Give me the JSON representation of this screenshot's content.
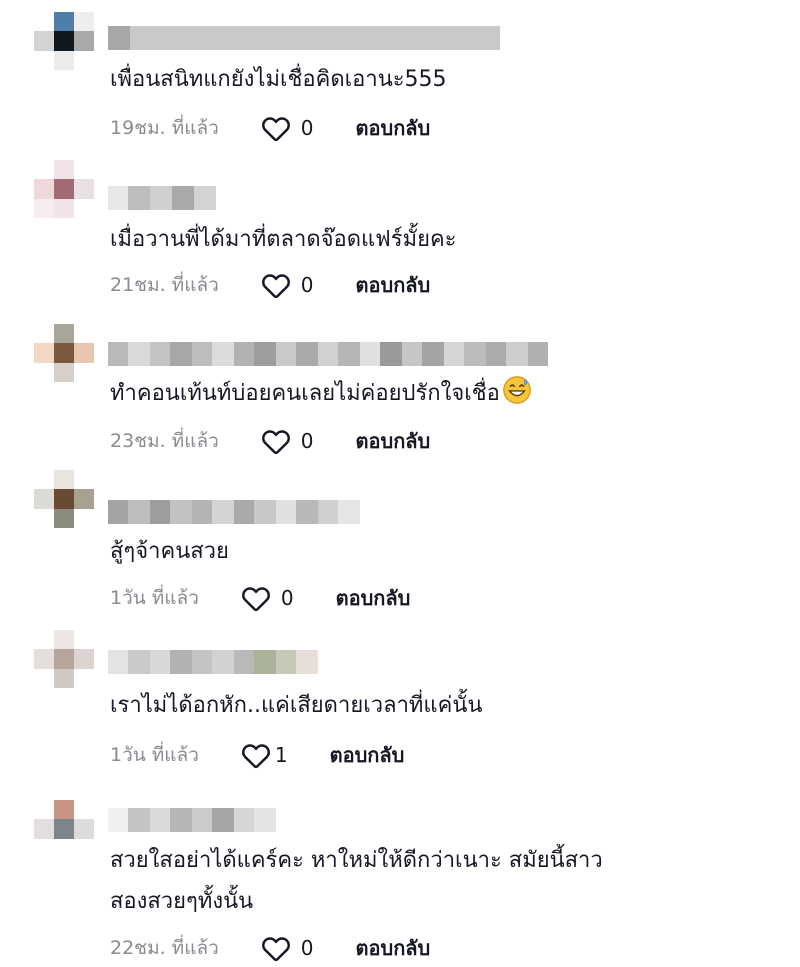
{
  "comments": [
    {
      "text": "เพื่อนสนิทแกยังไม่เชื่อคิดเอานะ555",
      "time": "19ชม. ที่แล้ว",
      "likes": "0",
      "reply": "ตอบกลับ"
    },
    {
      "text": "เมื่อวานพี่ได้มาที่ตลาดจ๊อดแฟร์มั้ยคะ",
      "time": "21ชม. ที่แล้ว",
      "likes": "0",
      "reply": "ตอบกลับ"
    },
    {
      "text": "ทำคอนเท้นท์บ่อยคนเลยไม่ค่อยปรักใจเชื่อ",
      "emoji": "grinning-face-with-sweat",
      "time": "23ชม. ที่แล้ว",
      "likes": "0",
      "reply": "ตอบกลับ"
    },
    {
      "text": "สู้ๆจ้าคนสวย",
      "time": "1วัน ที่แล้ว",
      "likes": "0",
      "reply": "ตอบกลับ"
    },
    {
      "text": "เราไม่ได้อกหัก..แค่เสียดายเวลาที่แค่นั้น",
      "time": "1วัน ที่แล้ว",
      "likes": "1",
      "reply": "ตอบกลับ"
    },
    {
      "text": "สวยใสอย่าได้แคร์คะ หาใหม่ให้ดีกว่าเนาะ สมัยนี้สาว",
      "text_line2": "สองสวยๆทั้งนั้น",
      "time": "22ชม. ที่แล้ว",
      "likes": "0",
      "reply": "ตอบกลับ"
    }
  ],
  "icons": {
    "like": "heart-outline-icon"
  },
  "colors": {
    "text": "#161823",
    "meta": "#8a8b91"
  }
}
